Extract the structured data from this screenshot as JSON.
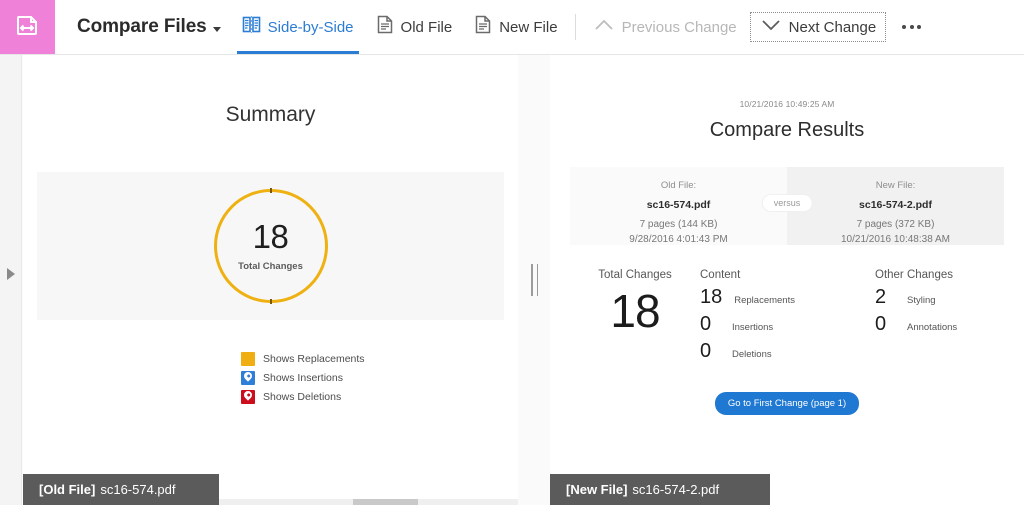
{
  "toolbar": {
    "logo_icon": "compare-files-logo-icon",
    "logo_color": "#f081d8",
    "title": "Compare Files",
    "items": [
      {
        "label": "Side-by-Side",
        "icon": "side-by-side-icon",
        "state": "active"
      },
      {
        "label": "Old File",
        "icon": "document-icon",
        "state": "normal"
      },
      {
        "label": "New File",
        "icon": "document-icon",
        "state": "normal"
      },
      {
        "label": "Previous Change",
        "icon": "chevron-up-icon",
        "state": "disabled"
      },
      {
        "label": "Next Change",
        "icon": "chevron-down-icon",
        "state": "boxed"
      }
    ],
    "overflow_label": "more-options",
    "accent_color": "#2b7cd3"
  },
  "left_panel": {
    "title": "Summary",
    "donut": {
      "value": "18",
      "caption": "Total Changes",
      "ring_color": "#eeb111"
    },
    "legend": [
      {
        "label": "Shows Replacements",
        "color": "#f0ae12",
        "icon": "replacement-swatch-icon"
      },
      {
        "label": "Shows Insertions",
        "color": "#2f7ed8",
        "icon": "insertion-pin-icon"
      },
      {
        "label": "Shows Deletions",
        "color": "#cc0d1e",
        "icon": "deletion-pin-icon"
      }
    ],
    "footer_badge": {
      "tag": "[Old File]",
      "name": "sc16-574.pdf"
    }
  },
  "right_panel": {
    "timestamp": "10/21/2016 10:49:25 AM",
    "title": "Compare Results",
    "old_file": {
      "label": "Old File:",
      "name": "sc16-574.pdf",
      "pages": "7 pages (144 KB)",
      "modified": "9/28/2016 4:01:43 PM"
    },
    "versus_label": "versus",
    "new_file": {
      "label": "New File:",
      "name": "sc16-574-2.pdf",
      "pages": "7 pages (372 KB)",
      "modified": "10/21/2016 10:48:38 AM"
    },
    "stats": {
      "total_heading": "Total Changes",
      "total_value": "18",
      "content_heading": "Content",
      "content_rows": [
        {
          "value": "18",
          "name": "Replacements"
        },
        {
          "value": "0",
          "name": "Insertions"
        },
        {
          "value": "0",
          "name": "Deletions"
        }
      ],
      "other_heading": "Other Changes",
      "other_rows": [
        {
          "value": "2",
          "name": "Styling"
        },
        {
          "value": "0",
          "name": "Annotations"
        }
      ]
    },
    "cta_label": "Go to First Change (page 1)",
    "cta_color": "#1f78d1",
    "footer_badge": {
      "tag": "[New File]",
      "name": "sc16-574-2.pdf"
    }
  }
}
